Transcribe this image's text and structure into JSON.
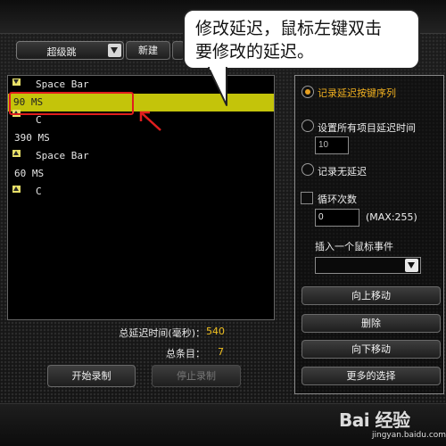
{
  "toolbar": {
    "profile_value": "超级跳",
    "new_button": "新建"
  },
  "callout": {
    "line1": "修改延迟，鼠标左键双击",
    "line2": "要修改的延迟。"
  },
  "events": [
    {
      "icon": "down",
      "text": "Space Bar"
    },
    {
      "icon": "",
      "text": "90 MS"
    },
    {
      "icon": "up",
      "text": "C"
    },
    {
      "icon": "",
      "text": "390 MS"
    },
    {
      "icon": "up",
      "text": "Space Bar"
    },
    {
      "icon": "",
      "text": "60 MS"
    },
    {
      "icon": "up",
      "text": "C"
    }
  ],
  "selected_index": 1,
  "stats": {
    "total_delay_label": "总延迟时间(毫秒)：",
    "total_delay_value": "540",
    "total_items_label": "总条目：",
    "total_items_value": "7"
  },
  "bottom_buttons": {
    "start_record": "开始录制",
    "stop_record": "停止录制"
  },
  "right_panel": {
    "option_record_delay": "记录延迟按键序列",
    "option_set_all_delay": "设置所有项目延迟时间",
    "delay_input_value": "10",
    "option_no_delay": "记录无延迟",
    "loop_label": "循环次数",
    "loop_input_value": "0",
    "loop_max": "(MAX:255)",
    "insert_mouse_label": "插入一个鼠标事件",
    "move_up": "向上移动",
    "delete": "删除",
    "move_down": "向下移动",
    "more_options": "更多的选择"
  },
  "watermark": {
    "big": "Bai 经验",
    "small": "jingyan.baidu.com"
  },
  "colors": {
    "selection": "#c4c40a",
    "accent": "#f0c020",
    "annotation_red": "#e01e1e"
  }
}
